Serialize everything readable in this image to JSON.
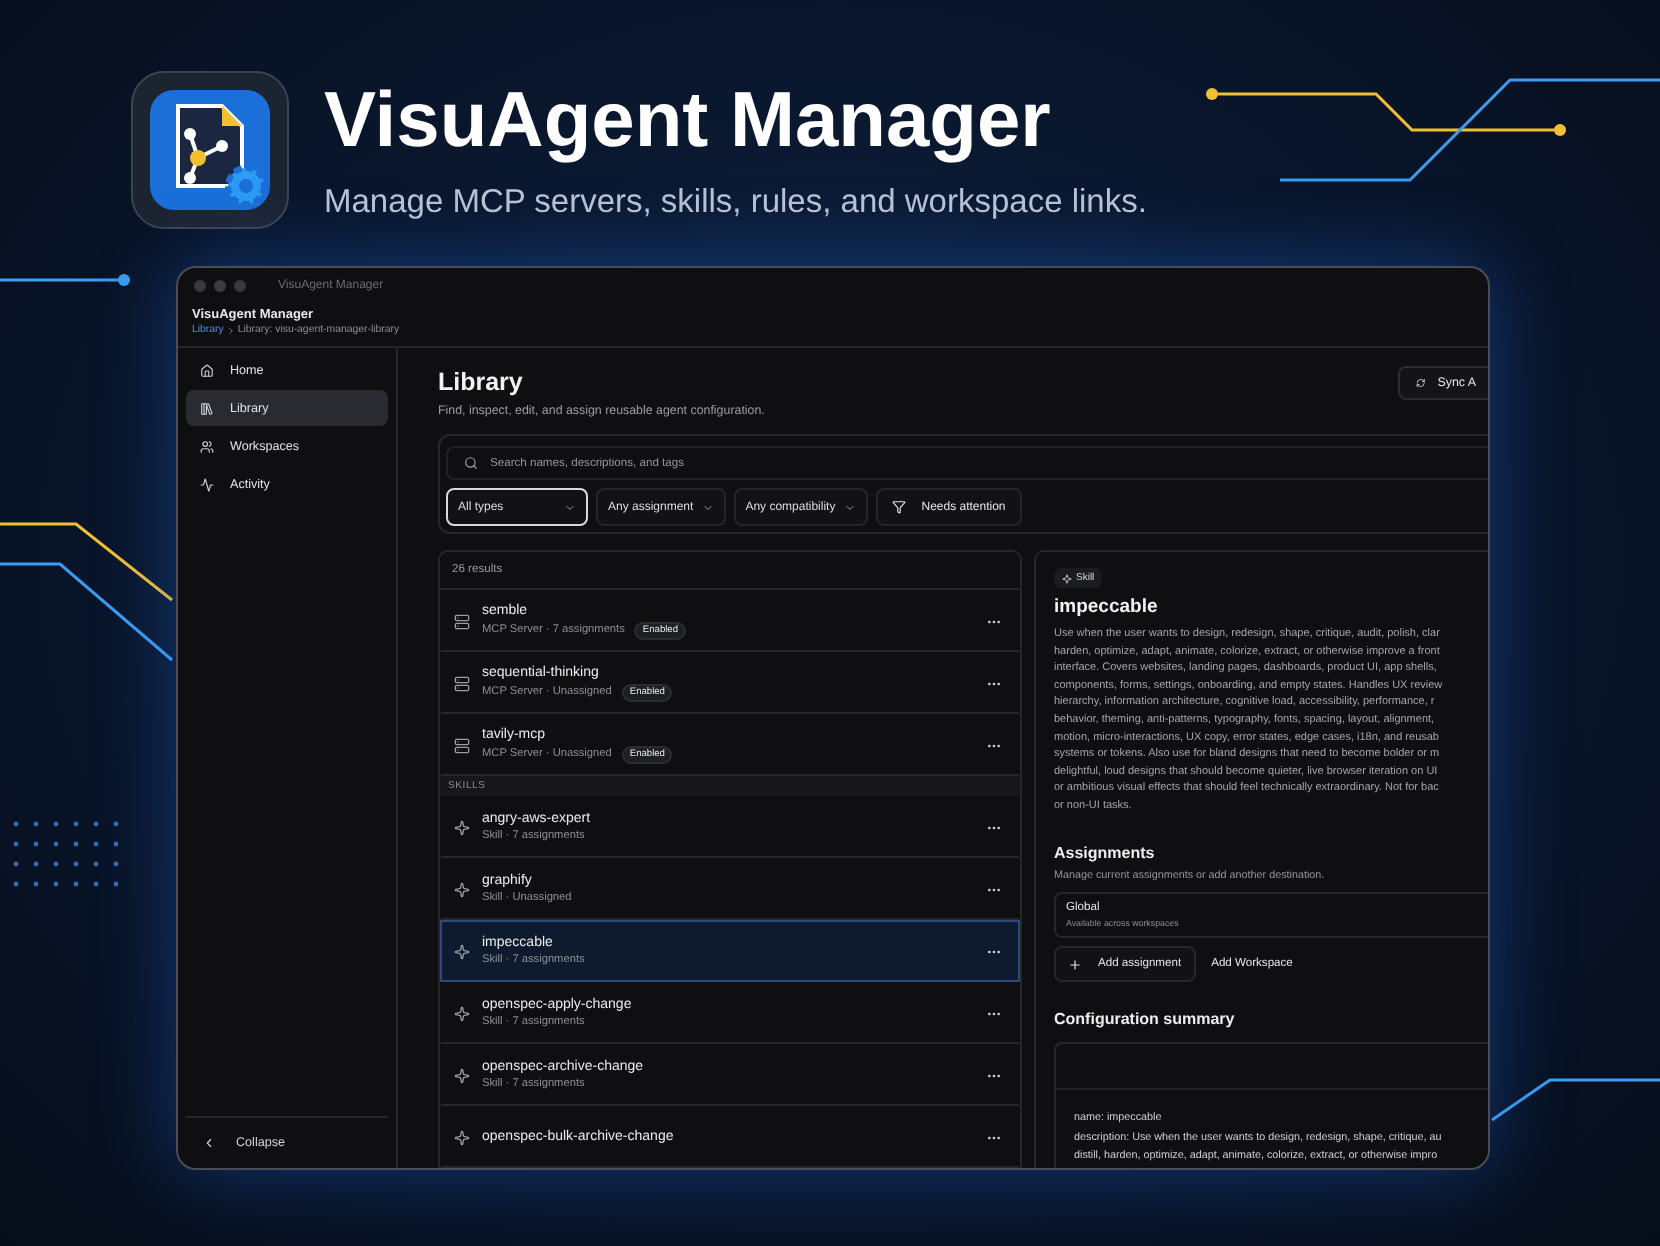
{
  "hero": {
    "title": "VisuAgent Manager",
    "subtitle": "Manage MCP servers, skills, rules, and workspace links."
  },
  "window": {
    "title": "VisuAgent Manager"
  },
  "app_header": {
    "app_name": "VisuAgent Manager",
    "breadcrumb_link": "Library",
    "breadcrumb_current": "Library: visu-agent-manager-library"
  },
  "sidebar": {
    "items": [
      {
        "label": "Home",
        "kind": "home",
        "selected": false
      },
      {
        "label": "Library",
        "kind": "library",
        "selected": true
      },
      {
        "label": "Workspaces",
        "kind": "users",
        "selected": false
      },
      {
        "label": "Activity",
        "kind": "activity",
        "selected": false
      }
    ],
    "collapse": "Collapse"
  },
  "library": {
    "title": "Library",
    "subtitle": "Find, inspect, edit, and assign reusable agent configuration.",
    "sync_button": "Sync A",
    "search": {
      "placeholder": "Search names, descriptions, and tags"
    },
    "filters": [
      {
        "label": "All types",
        "kind": "select",
        "selected": true
      },
      {
        "label": "Any assignment",
        "kind": "select",
        "selected": false
      },
      {
        "label": "Any compatibility",
        "kind": "select",
        "selected": false
      },
      {
        "label": "Needs attention",
        "kind": "toggle",
        "selected": false
      }
    ],
    "results_count": "26 results",
    "sections": [
      {
        "rows": [
          {
            "name": "semble",
            "meta": "MCP Server · 7 assignments",
            "badge": "Enabled",
            "kind": "server",
            "selected": false
          },
          {
            "name": "sequential-thinking",
            "meta": "MCP Server · Unassigned",
            "badge": "Enabled",
            "kind": "server",
            "selected": false
          },
          {
            "name": "tavily-mcp",
            "meta": "MCP Server · Unassigned",
            "badge": "Enabled",
            "kind": "server",
            "selected": false
          }
        ]
      },
      {
        "heading": "SKILLS",
        "rows": [
          {
            "name": "angry-aws-expert",
            "meta": "Skill · 7 assignments",
            "kind": "skill",
            "selected": false
          },
          {
            "name": "graphify",
            "meta": "Skill · Unassigned",
            "kind": "skill",
            "selected": false
          },
          {
            "name": "impeccable",
            "meta": "Skill · 7 assignments",
            "kind": "skill",
            "selected": true
          },
          {
            "name": "openspec-apply-change",
            "meta": "Skill · 7 assignments",
            "kind": "skill",
            "selected": false
          },
          {
            "name": "openspec-archive-change",
            "meta": "Skill · 7 assignments",
            "kind": "skill",
            "selected": false
          },
          {
            "name": "openspec-bulk-archive-change",
            "kind": "skill",
            "selected": false
          }
        ]
      }
    ]
  },
  "detail": {
    "type_badge": "Skill",
    "title": "impeccable",
    "description_lines": [
      "Use when the user wants to design, redesign, shape, critique, audit, polish, clar",
      "harden, optimize, adapt, animate, colorize, extract, or otherwise improve a front",
      "interface. Covers websites, landing pages, dashboards, product UI, app shells,",
      "components, forms, settings, onboarding, and empty states. Handles UX review",
      "hierarchy, information architecture, cognitive load, accessibility, performance, r",
      "behavior, theming, anti-patterns, typography, fonts, spacing, layout, alignment,",
      "motion, micro-interactions, UX copy, error states, edge cases, i18n, and reusab",
      "systems or tokens. Also use for bland designs that need to become bolder or m",
      "delightful, loud designs that should become quieter, live browser iteration on UI",
      "or ambitious visual effects that should feel technically extraordinary. Not for bac",
      "or non-UI tasks."
    ],
    "assignments": {
      "title": "Assignments",
      "subtitle": "Manage current assignments or add another destination.",
      "items": [
        {
          "name": "Global",
          "note": "Available across workspaces"
        }
      ],
      "add_button": "Add assignment",
      "add_workspace": "Add Workspace"
    },
    "config": {
      "title": "Configuration summary",
      "lines": [
        "name: impeccable",
        "description: Use when the user wants to design, redesign, shape, critique, au",
        "distill, harden, optimize, adapt, animate, colorize, extract, or otherwise impro"
      ]
    }
  }
}
